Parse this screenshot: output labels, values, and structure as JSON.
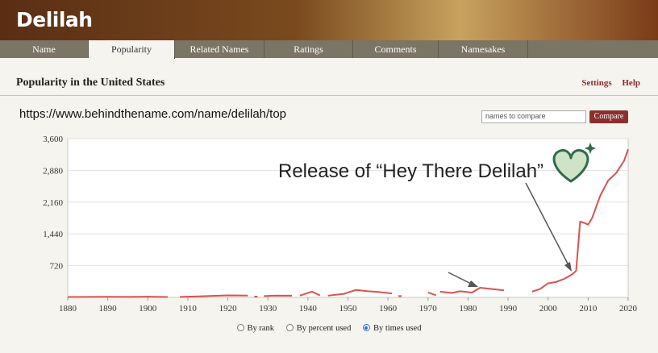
{
  "site": {
    "name": "Delilah"
  },
  "tabs": [
    {
      "label": "Name"
    },
    {
      "label": "Popularity",
      "active": true
    },
    {
      "label": "Related Names"
    },
    {
      "label": "Ratings"
    },
    {
      "label": "Comments"
    },
    {
      "label": "Namesakes"
    }
  ],
  "section": {
    "title": "Popularity in the United States",
    "settings": "Settings",
    "help": "Help"
  },
  "url": "https://www.behindthename.com/name/delilah/top",
  "compare": {
    "placeholder": "names to compare",
    "button": "Compare"
  },
  "annotation": "Release of “Hey There Delilah”",
  "radios": [
    {
      "label": "By rank",
      "checked": false
    },
    {
      "label": "By percent used",
      "checked": false
    },
    {
      "label": "By times used",
      "checked": true
    }
  ],
  "colors": {
    "line": "#d9534f",
    "accent": "#8b2f2f",
    "heart": "#2f6b4a"
  },
  "chart_data": {
    "type": "line",
    "xlim": [
      1880,
      2020
    ],
    "ylim": [
      0,
      3600
    ],
    "xticks": [
      1880,
      1890,
      1900,
      1910,
      1920,
      1930,
      1940,
      1950,
      1960,
      1970,
      1980,
      1990,
      2000,
      2010,
      2020
    ],
    "yticks": [
      720,
      1440,
      2160,
      2880,
      3600
    ],
    "ytick_labels": [
      "720",
      "1,440",
      "2,160",
      "2,880",
      "3,600"
    ],
    "series": [
      {
        "segments": [
          [
            [
              1880,
              10
            ],
            [
              1885,
              12
            ],
            [
              1890,
              14
            ],
            [
              1895,
              12
            ],
            [
              1900,
              15
            ],
            [
              1905,
              10
            ]
          ],
          [
            [
              1908,
              12
            ],
            [
              1912,
              20
            ],
            [
              1916,
              35
            ],
            [
              1920,
              45
            ],
            [
              1925,
              40
            ]
          ],
          [
            [
              1927,
              18
            ]
          ],
          [
            [
              1929,
              30
            ],
            [
              1932,
              40
            ],
            [
              1936,
              38
            ]
          ],
          [
            [
              1938,
              40
            ],
            [
              1941,
              130
            ],
            [
              1943,
              45
            ]
          ],
          [
            [
              1945,
              40
            ],
            [
              1949,
              80
            ],
            [
              1952,
              170
            ],
            [
              1955,
              140
            ],
            [
              1958,
              120
            ],
            [
              1961,
              90
            ]
          ],
          [
            [
              1963,
              30
            ]
          ],
          [
            [
              1970,
              110
            ],
            [
              1972,
              50
            ]
          ],
          [
            [
              1973,
              130
            ],
            [
              1976,
              100
            ],
            [
              1978,
              140
            ],
            [
              1981,
              110
            ],
            [
              1983,
              220
            ],
            [
              1986,
              190
            ],
            [
              1989,
              160
            ]
          ],
          [
            [
              1996,
              130
            ],
            [
              1998,
              190
            ],
            [
              2000,
              320
            ],
            [
              2002,
              350
            ],
            [
              2004,
              420
            ],
            [
              2006,
              520
            ],
            [
              2007,
              600
            ],
            [
              2008,
              1720
            ],
            [
              2009,
              1690
            ],
            [
              2010,
              1650
            ],
            [
              2011,
              1800
            ],
            [
              2013,
              2300
            ],
            [
              2015,
              2650
            ],
            [
              2017,
              2820
            ],
            [
              2019,
              3100
            ],
            [
              2020,
              3360
            ]
          ]
        ]
      }
    ]
  }
}
